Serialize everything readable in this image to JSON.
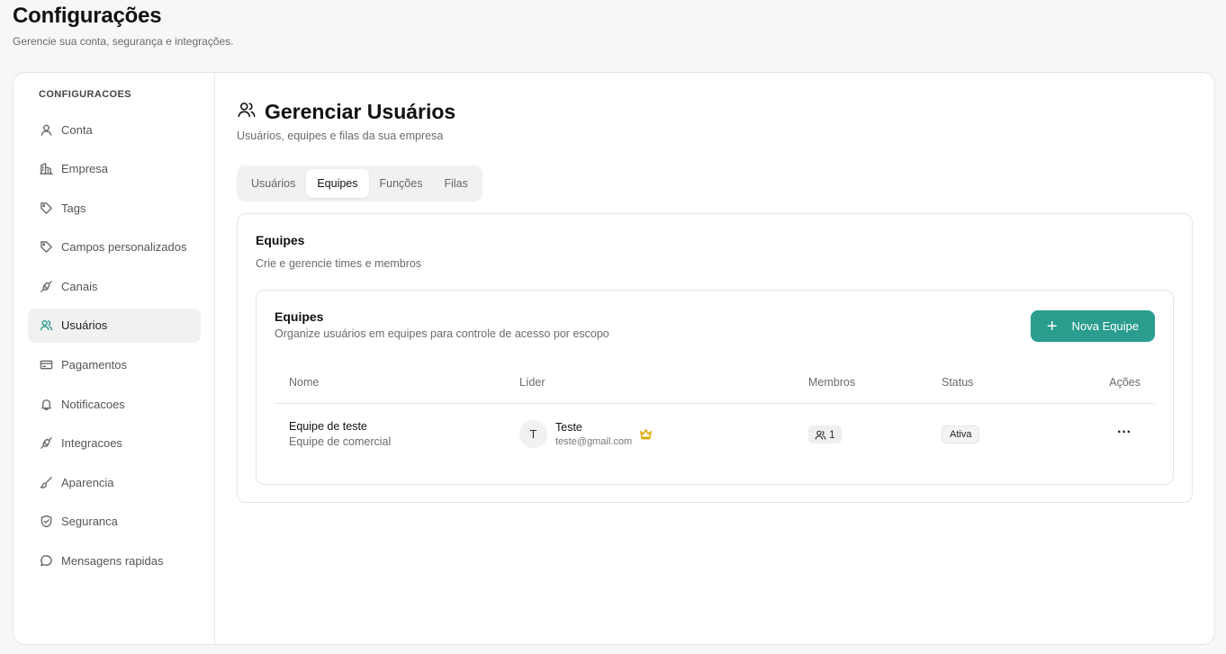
{
  "page": {
    "title": "Configurações",
    "subtitle": "Gerencie sua conta, segurança e integrações."
  },
  "sidebar": {
    "heading": "CONFIGURACOES",
    "items": [
      {
        "label": "Conta",
        "icon": "user-icon"
      },
      {
        "label": "Empresa",
        "icon": "building-icon"
      },
      {
        "label": "Tags",
        "icon": "tag-icon"
      },
      {
        "label": "Campos personalizados",
        "icon": "tag-icon"
      },
      {
        "label": "Canais",
        "icon": "plug-icon"
      },
      {
        "label": "Usuários",
        "icon": "users-icon",
        "active": true
      },
      {
        "label": "Pagamentos",
        "icon": "credit-card-icon"
      },
      {
        "label": "Notificacoes",
        "icon": "bell-icon"
      },
      {
        "label": "Integracoes",
        "icon": "plug-icon"
      },
      {
        "label": "Aparencia",
        "icon": "brush-icon"
      },
      {
        "label": "Seguranca",
        "icon": "shield-icon"
      },
      {
        "label": "Mensagens rapidas",
        "icon": "message-icon"
      }
    ]
  },
  "main": {
    "title": "Gerenciar Usuários",
    "subtitle": "Usuários, equipes e filas da sua empresa",
    "tabs": [
      {
        "label": "Usuários"
      },
      {
        "label": "Equipes",
        "active": true
      },
      {
        "label": "Funções"
      },
      {
        "label": "Filas"
      }
    ],
    "panel": {
      "title": "Equipes",
      "subtitle": "Crie e gerencie times e membros"
    },
    "teams_card": {
      "title": "Equipes",
      "subtitle": "Organize usuários em equipes para controle de acesso por escopo",
      "new_button_label": "Nova Equipe",
      "columns": {
        "name": "Nome",
        "leader": "Líder",
        "members": "Membros",
        "status": "Status",
        "actions": "Ações"
      },
      "rows": [
        {
          "name": "Equipe de teste",
          "description": "Equipe de comercial",
          "leader_initial": "T",
          "leader_name": "Teste",
          "leader_email": "teste@gmail.com",
          "members": "1",
          "status": "Ativa",
          "actions": "···"
        }
      ]
    }
  },
  "colors": {
    "accent": "#2a9d8f",
    "crown": "#e0a800"
  }
}
